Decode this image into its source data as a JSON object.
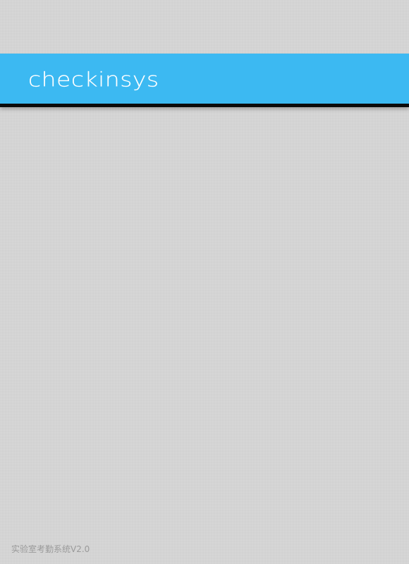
{
  "header": {
    "logo_text": "checkinsys"
  },
  "footer": {
    "version_text": "实验室考勤系统V2.0"
  },
  "colors": {
    "header_bar": "#3cb9f2",
    "header_border": "#0b0b0b",
    "background": "#d4d4d4",
    "footer_text": "#9a9a9a",
    "logo_text": "#ffffff"
  }
}
